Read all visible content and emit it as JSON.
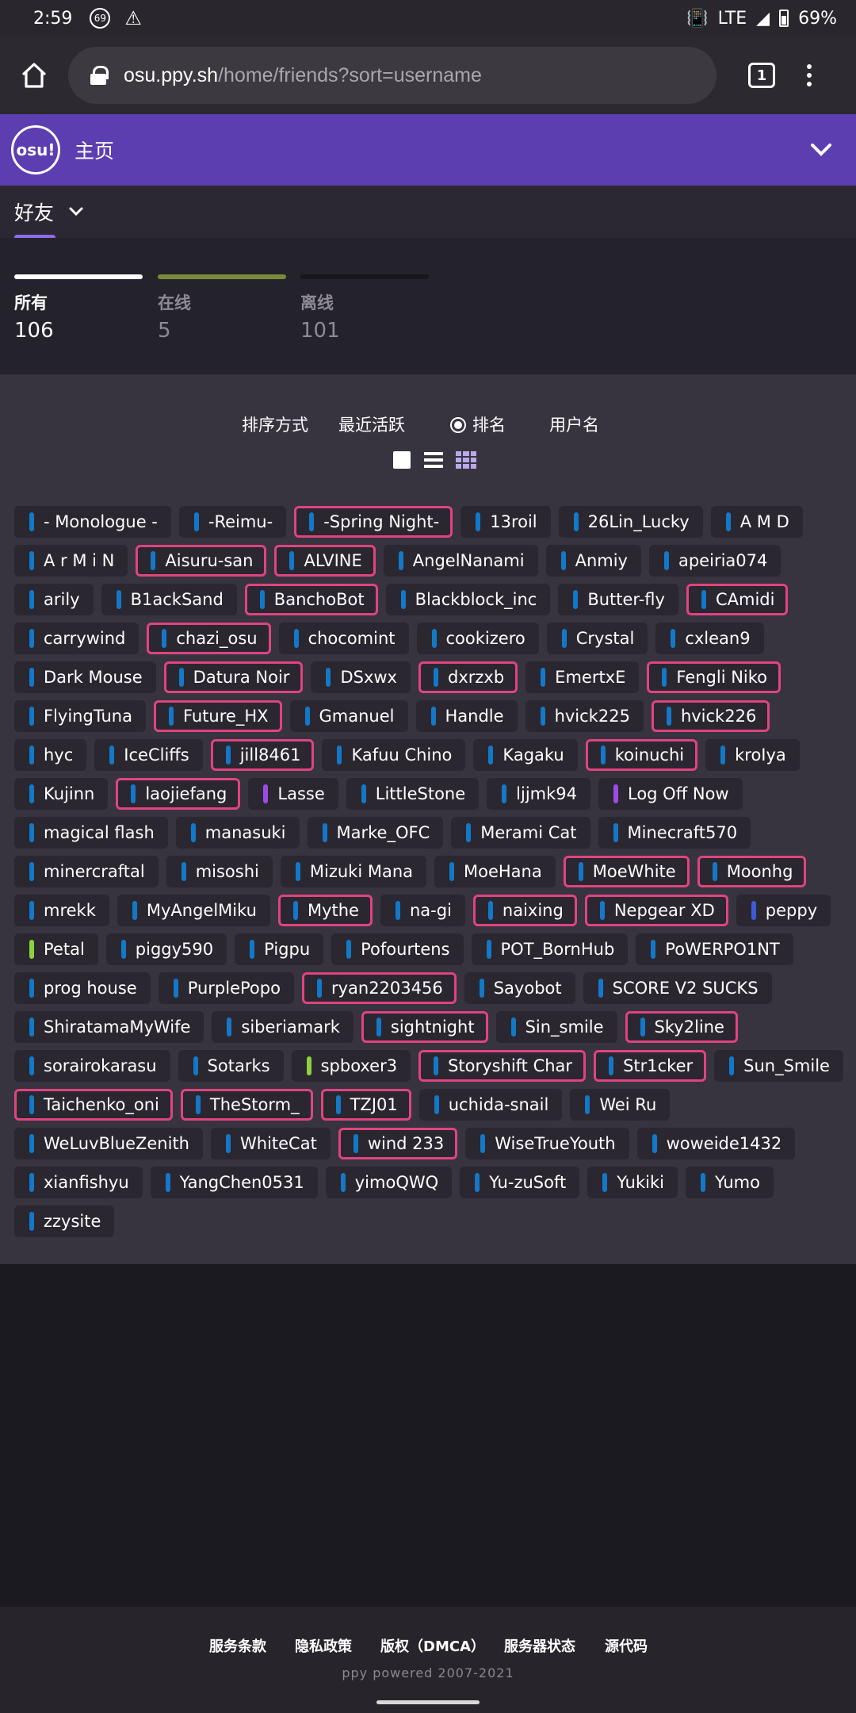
{
  "status_bar": {
    "time": "2:59",
    "notif_badge": "69",
    "network": "LTE",
    "battery": "69%"
  },
  "browser": {
    "url_host": "osu.ppy.sh",
    "url_path": "/home/friends?sort=username",
    "tab_count": "1"
  },
  "header": {
    "logo": "osu!",
    "title": "主页"
  },
  "subheader": {
    "title": "好友"
  },
  "stats": [
    {
      "label": "所有",
      "value": "106",
      "color": "#ffffff"
    },
    {
      "label": "在线",
      "value": "5",
      "color": "#7a8a3a"
    },
    {
      "label": "离线",
      "value": "101",
      "color": "#18161c"
    }
  ],
  "sort": {
    "label": "排序方式",
    "options": [
      "最近活跃",
      "排名",
      "用户名"
    ],
    "selected": "排名"
  },
  "view_modes": [
    "card-view-icon",
    "list-view-icon",
    "brick-view-icon"
  ],
  "status_colors": {
    "blue": "#1478c8",
    "purple": "#9b4be6",
    "green": "#8cd23c",
    "dark_blue": "#3d5bd6"
  },
  "friends": [
    {
      "name": "- Monologue -",
      "hl": false,
      "status": "blue"
    },
    {
      "name": "-Reimu-",
      "hl": false,
      "status": "blue"
    },
    {
      "name": "-Spring Night-",
      "hl": true,
      "status": "blue"
    },
    {
      "name": "13roil",
      "hl": false,
      "status": "blue"
    },
    {
      "name": "26Lin_Lucky",
      "hl": false,
      "status": "blue"
    },
    {
      "name": "A M D",
      "hl": false,
      "status": "blue"
    },
    {
      "name": "A r M i N",
      "hl": false,
      "status": "blue"
    },
    {
      "name": "Aisuru-san",
      "hl": true,
      "status": "blue"
    },
    {
      "name": "ALVINE",
      "hl": true,
      "status": "blue"
    },
    {
      "name": "AngelNanami",
      "hl": false,
      "status": "blue"
    },
    {
      "name": "Anmiy",
      "hl": false,
      "status": "blue"
    },
    {
      "name": "apeiria074",
      "hl": false,
      "status": "blue"
    },
    {
      "name": "arily",
      "hl": false,
      "status": "blue"
    },
    {
      "name": "B1ackSand",
      "hl": false,
      "status": "blue"
    },
    {
      "name": "BanchoBot",
      "hl": true,
      "status": "blue"
    },
    {
      "name": "Blackblock_inc",
      "hl": false,
      "status": "blue"
    },
    {
      "name": "Butter-fly",
      "hl": false,
      "status": "blue"
    },
    {
      "name": "CAmidi",
      "hl": true,
      "status": "blue"
    },
    {
      "name": "carrywind",
      "hl": false,
      "status": "blue"
    },
    {
      "name": "chazi_osu",
      "hl": true,
      "status": "blue"
    },
    {
      "name": "chocomint",
      "hl": false,
      "status": "blue"
    },
    {
      "name": "cookizero",
      "hl": false,
      "status": "blue"
    },
    {
      "name": "Crystal",
      "hl": false,
      "status": "blue"
    },
    {
      "name": "cxlean9",
      "hl": false,
      "status": "blue"
    },
    {
      "name": "Dark Mouse",
      "hl": false,
      "status": "blue"
    },
    {
      "name": "Datura Noir",
      "hl": true,
      "status": "blue"
    },
    {
      "name": "DSxwx",
      "hl": false,
      "status": "blue"
    },
    {
      "name": "dxrzxb",
      "hl": true,
      "status": "blue"
    },
    {
      "name": "EmertxE",
      "hl": false,
      "status": "blue"
    },
    {
      "name": "Fengli Niko",
      "hl": true,
      "status": "blue"
    },
    {
      "name": "FlyingTuna",
      "hl": false,
      "status": "blue"
    },
    {
      "name": "Future_HX",
      "hl": true,
      "status": "blue"
    },
    {
      "name": "Gmanuel",
      "hl": false,
      "status": "blue"
    },
    {
      "name": "Handle",
      "hl": false,
      "status": "blue"
    },
    {
      "name": "hvick225",
      "hl": false,
      "status": "blue"
    },
    {
      "name": "hvick226",
      "hl": true,
      "status": "blue"
    },
    {
      "name": "hyc",
      "hl": false,
      "status": "blue"
    },
    {
      "name": "IceCliffs",
      "hl": false,
      "status": "blue"
    },
    {
      "name": "jill8461",
      "hl": true,
      "status": "blue"
    },
    {
      "name": "Kafuu Chino",
      "hl": false,
      "status": "blue"
    },
    {
      "name": "Kagaku",
      "hl": false,
      "status": "blue"
    },
    {
      "name": "koinuchi",
      "hl": true,
      "status": "blue"
    },
    {
      "name": "kroIya",
      "hl": false,
      "status": "blue"
    },
    {
      "name": "Kujinn",
      "hl": false,
      "status": "blue"
    },
    {
      "name": "laojiefang",
      "hl": true,
      "status": "blue"
    },
    {
      "name": "Lasse",
      "hl": false,
      "status": "purple"
    },
    {
      "name": "LittleStone",
      "hl": false,
      "status": "blue"
    },
    {
      "name": "ljjmk94",
      "hl": false,
      "status": "blue"
    },
    {
      "name": "Log Off Now",
      "hl": false,
      "status": "purple"
    },
    {
      "name": "magical flash",
      "hl": false,
      "status": "blue"
    },
    {
      "name": "manasuki",
      "hl": false,
      "status": "blue"
    },
    {
      "name": "Marke_OFC",
      "hl": false,
      "status": "blue"
    },
    {
      "name": "Merami Cat",
      "hl": false,
      "status": "blue"
    },
    {
      "name": "Minecraft570",
      "hl": false,
      "status": "blue"
    },
    {
      "name": "minercraftal",
      "hl": false,
      "status": "blue"
    },
    {
      "name": "misoshi",
      "hl": false,
      "status": "blue"
    },
    {
      "name": "Mizuki Mana",
      "hl": false,
      "status": "blue"
    },
    {
      "name": "MoeHana",
      "hl": false,
      "status": "blue"
    },
    {
      "name": "MoeWhite",
      "hl": true,
      "status": "blue"
    },
    {
      "name": "Moonhg",
      "hl": true,
      "status": "blue"
    },
    {
      "name": "mrekk",
      "hl": false,
      "status": "blue"
    },
    {
      "name": "MyAngelMiku",
      "hl": false,
      "status": "blue"
    },
    {
      "name": "Mythe",
      "hl": true,
      "status": "blue"
    },
    {
      "name": "na-gi",
      "hl": false,
      "status": "blue"
    },
    {
      "name": "naixing",
      "hl": true,
      "status": "blue"
    },
    {
      "name": "Nepgear XD",
      "hl": true,
      "status": "blue"
    },
    {
      "name": "peppy",
      "hl": false,
      "status": "dark_blue"
    },
    {
      "name": "Petal",
      "hl": false,
      "status": "green"
    },
    {
      "name": "piggy590",
      "hl": false,
      "status": "blue"
    },
    {
      "name": "Pigpu",
      "hl": false,
      "status": "blue"
    },
    {
      "name": "Pofourtens",
      "hl": false,
      "status": "blue"
    },
    {
      "name": "POT_BornHub",
      "hl": false,
      "status": "blue"
    },
    {
      "name": "PoWERPO1NT",
      "hl": false,
      "status": "blue"
    },
    {
      "name": "prog house",
      "hl": false,
      "status": "blue"
    },
    {
      "name": "PurplePopo",
      "hl": false,
      "status": "blue"
    },
    {
      "name": "ryan2203456",
      "hl": true,
      "status": "blue"
    },
    {
      "name": "Sayobot",
      "hl": false,
      "status": "blue"
    },
    {
      "name": "SCORE V2 SUCKS",
      "hl": false,
      "status": "blue"
    },
    {
      "name": "ShiratamaMyWife",
      "hl": false,
      "status": "blue"
    },
    {
      "name": "siberiamark",
      "hl": false,
      "status": "blue"
    },
    {
      "name": "sightnight",
      "hl": true,
      "status": "blue"
    },
    {
      "name": "Sin_smile",
      "hl": false,
      "status": "blue"
    },
    {
      "name": "Sky2line",
      "hl": true,
      "status": "blue"
    },
    {
      "name": "sorairokarasu",
      "hl": false,
      "status": "blue"
    },
    {
      "name": "Sotarks",
      "hl": false,
      "status": "blue"
    },
    {
      "name": "spboxer3",
      "hl": false,
      "status": "green"
    },
    {
      "name": "Storyshift Char",
      "hl": true,
      "status": "blue"
    },
    {
      "name": "Str1cker",
      "hl": true,
      "status": "blue"
    },
    {
      "name": "Sun_Smile",
      "hl": false,
      "status": "blue"
    },
    {
      "name": "Taichenko_oni",
      "hl": true,
      "status": "blue"
    },
    {
      "name": "TheStorm_",
      "hl": true,
      "status": "blue"
    },
    {
      "name": "TZJ01",
      "hl": true,
      "status": "blue"
    },
    {
      "name": "uchida-snail",
      "hl": false,
      "status": "blue"
    },
    {
      "name": "Wei Ru",
      "hl": false,
      "status": "blue"
    },
    {
      "name": "WeLuvBlueZenith",
      "hl": false,
      "status": "blue"
    },
    {
      "name": "WhiteCat",
      "hl": false,
      "status": "blue"
    },
    {
      "name": "wind 233",
      "hl": true,
      "status": "blue"
    },
    {
      "name": "WiseTrueYouth",
      "hl": false,
      "status": "blue"
    },
    {
      "name": "woweide1432",
      "hl": false,
      "status": "blue"
    },
    {
      "name": "xianfishyu",
      "hl": false,
      "status": "blue"
    },
    {
      "name": "YangChen0531",
      "hl": false,
      "status": "blue"
    },
    {
      "name": "yimoQWQ",
      "hl": false,
      "status": "blue"
    },
    {
      "name": "Yu-zuSoft",
      "hl": false,
      "status": "blue"
    },
    {
      "name": "Yukiki",
      "hl": false,
      "status": "blue"
    },
    {
      "name": "Yumo",
      "hl": false,
      "status": "blue"
    },
    {
      "name": "zzysite",
      "hl": false,
      "status": "blue"
    }
  ],
  "footer": {
    "links": [
      "服务条款",
      "隐私政策",
      "版权（DMCA）",
      "服务器状态",
      "源代码"
    ],
    "powered": "ppy powered 2007-2021"
  }
}
